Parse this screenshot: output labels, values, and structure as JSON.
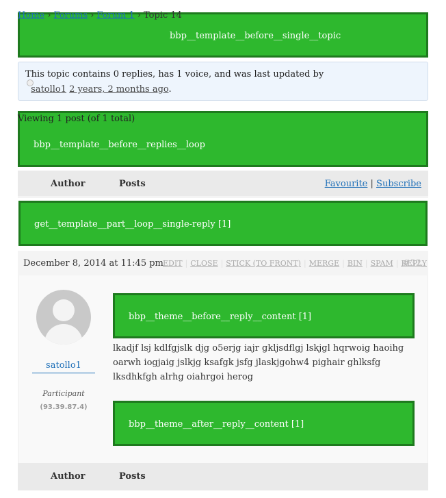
{
  "breadcrumb": {
    "items": [
      "Home",
      "Forums",
      "Forum 1"
    ],
    "separator": "›",
    "current": "Topic 14"
  },
  "hooks": {
    "before_single_topic": "bbp__template__before__single__topic",
    "before_replies_loop": "bbp__template__before__replies__loop",
    "loop_single_reply": "get__template__part__loop__single-reply [1]",
    "before_reply_content": "bbp__theme__before__reply__content [1]",
    "after_reply_content": "bbp__theme__after__reply__content [1]"
  },
  "topic_info": {
    "text": "This topic contains 0 replies, has 1 voice, and was last updated by",
    "author": "satollo1",
    "freshness": "2 years, 2 months ago",
    "period": "."
  },
  "pagination": {
    "count": "Viewing 1 post (of 1 total)"
  },
  "table_header": {
    "author": "Author",
    "posts": "Posts",
    "favourite": "Favourite",
    "divider": "|",
    "subscribe": "Subscribe"
  },
  "reply": {
    "date": "December 8, 2014 at 11:45 pm",
    "admin_links": [
      "EDIT",
      "CLOSE",
      "STICK (TO FRONT)",
      "MERGE",
      "BIN",
      "SPAM",
      "REPLY"
    ],
    "permalink": "#32",
    "author": "satollo1",
    "role": "Participant",
    "ip": "(93.39.87.4)",
    "content": "lkadjf lsj kdlfgjslk djg o5erjg iajr gkljsdflgj lskjgl hqrwoig haoihg oarwh iogjaig jslkjg ksafgk jsfg jlaskjgohw4 pighair ghlksfg lksdhkfgh alrhg oiahrgoi herog"
  },
  "table_footer": {
    "author": "Author",
    "posts": "Posts"
  },
  "colors": {
    "hook_bg": "#2eb82e",
    "hook_border": "#1e7a1e",
    "link": "#1e6fb8",
    "info_bg": "#eef5fd"
  }
}
